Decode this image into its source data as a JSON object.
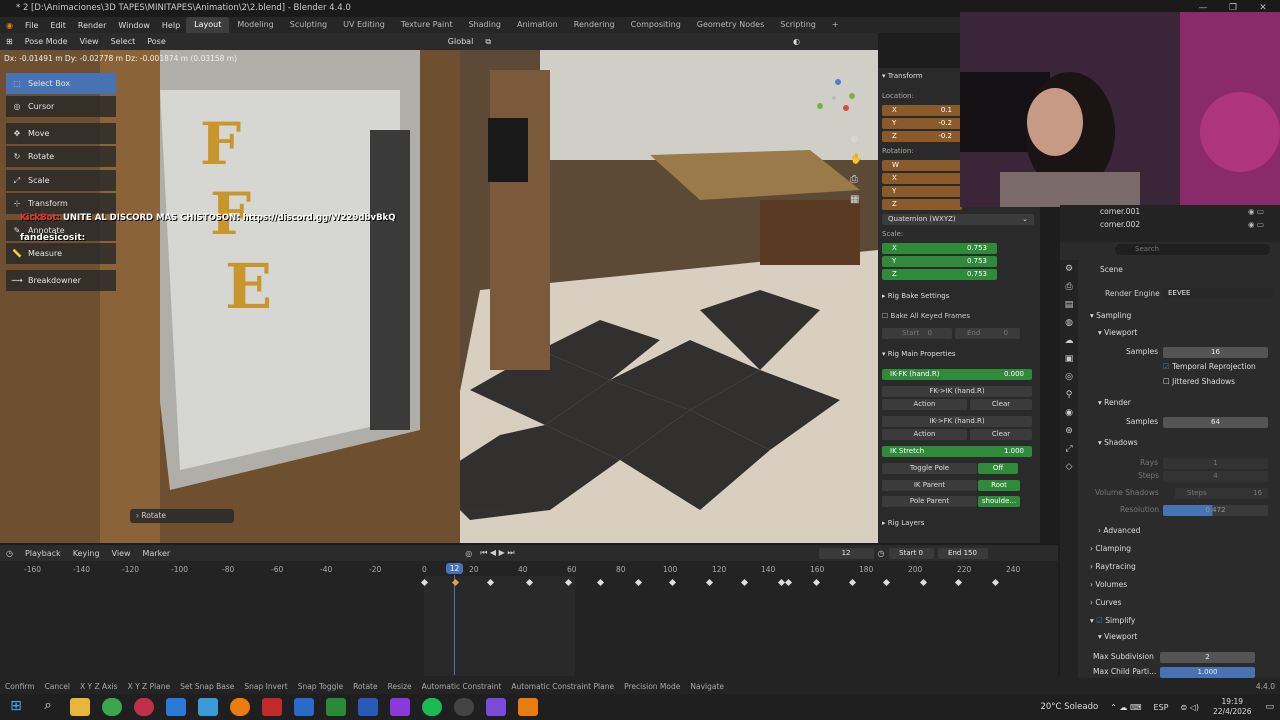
{
  "window": {
    "title": "* 2 [D:\\Animaciones\\3D TAPES\\MINITAPES\\Animation\\2\\2.blend] - Blender 4.4.0"
  },
  "menu": [
    "File",
    "Edit",
    "Render",
    "Window",
    "Help"
  ],
  "workspaces": [
    "Layout",
    "Modeling",
    "Sculpting",
    "UV Editing",
    "Texture Paint",
    "Shading",
    "Animation",
    "Rendering",
    "Compositing",
    "Geometry Nodes",
    "Scripting"
  ],
  "viewport_header": {
    "mode": "Pose Mode",
    "items": [
      "View",
      "Select",
      "Pose"
    ],
    "orientation": "Global"
  },
  "status_delta": "Dx: -0.01491 m  Dy: -0.02778 m  Dz: -0.001874 m (0.03158 m)",
  "tools": [
    "Select Box",
    "Cursor",
    "Move",
    "Rotate",
    "Scale",
    "Transform",
    "Annotate",
    "Measure",
    "Breakdowner"
  ],
  "chat": {
    "user1": "KickBot:",
    "msg1": "UNITE AL DISCORD MAS CHISTOSON: https://discord.gg/W229dbvBkQ",
    "user2": "fandesicosit:"
  },
  "sign_letters": [
    "F",
    "F",
    "E"
  ],
  "last_op": "Rotate",
  "npanel": {
    "transform": "Transform",
    "location": "Location:",
    "loc": [
      {
        "a": "X",
        "v": "0.1"
      },
      {
        "a": "Y",
        "v": "-0.2"
      },
      {
        "a": "Z",
        "v": "-0.2"
      }
    ],
    "rotation": "Rotation:",
    "rot": [
      "W",
      "X",
      "Y",
      "Z"
    ],
    "rotmode": "Quaternion (WXYZ)",
    "scale": "Scale:",
    "scl": [
      {
        "a": "X",
        "v": "0.753"
      },
      {
        "a": "Y",
        "v": "0.753"
      },
      {
        "a": "Z",
        "v": "0.753"
      }
    ],
    "bake": "Rig Bake Settings",
    "bake_all": "Bake All Keyed Frames",
    "start": "Start",
    "start_v": "0",
    "end": "End",
    "end_v": "0",
    "rigmain": "Rig Main Properties",
    "ikfk": "IK-FK (hand.R)",
    "ikfk_v": "0.000",
    "fk2ik": "FK->IK (hand.R)",
    "ik2fk": "IK->FK (hand.R)",
    "action": "Action",
    "clear": "Clear",
    "ikstretch": "IK Stretch",
    "ikstretch_v": "1.000",
    "togglepole": "Toggle Pole",
    "togglepole_v": "Off",
    "ikparent": "IK Parent",
    "ikparent_v": "Root",
    "poleparent": "Pole Parent",
    "poleparent_v": "shoulde...",
    "riglayers": "Rig Layers"
  },
  "outliner": [
    {
      "name": "corner.001"
    },
    {
      "name": "corner.002"
    }
  ],
  "props": {
    "search": "Search",
    "scene": "Scene",
    "engine_label": "Render Engine",
    "engine": "EEVEE",
    "sampling": "Sampling",
    "viewport": "Viewport",
    "samples": "Samples",
    "vp_samples": "16",
    "temporal": "Temporal Reprojection",
    "jittered": "Jittered Shadows",
    "render": "Render",
    "r_samples": "64",
    "shadows": "Shadows",
    "rays": "Rays",
    "rays_v": "1",
    "steps": "Steps",
    "steps_v": "4",
    "vol_shadows": "Volume Shadows",
    "vol_steps": "Steps",
    "vol_steps_v": "16",
    "resolution": "Resolution",
    "resolution_v": "0.472",
    "advanced": "Advanced",
    "clamping": "Clamping",
    "raytracing": "Raytracing",
    "volumes": "Volumes",
    "curves": "Curves",
    "simplify": "Simplify",
    "viewport2": "Viewport",
    "maxsubdiv": "Max Subdivision",
    "maxsubdiv_v": "2",
    "maxchild": "Max Child Parti...",
    "maxchild_v": "1.000"
  },
  "timeline": {
    "items": [
      "Playback",
      "Keying",
      "View",
      "Marker"
    ],
    "current": "12",
    "start_label": "Start",
    "start": "0",
    "end_label": "End",
    "end": "150",
    "ticks": [
      "-160",
      "-140",
      "-120",
      "-100",
      "-80",
      "-60",
      "-40",
      "-20",
      "0",
      "20",
      "40",
      "60",
      "80",
      "100",
      "120",
      "140",
      "160",
      "180",
      "200",
      "220",
      "240"
    ]
  },
  "statusbar": [
    "Confirm",
    "Cancel",
    "X Y Z Axis",
    "X Y Z Plane",
    "Set Snap Base",
    "Snap Invert",
    "Snap Toggle",
    "Rotate",
    "Resize",
    "Automatic Constraint",
    "Automatic Constraint Plane",
    "Precision Mode",
    "Navigate"
  ],
  "version": "4.4.0",
  "taskbar": {
    "weather": "20°C Soleado",
    "lang": "ESP",
    "time": "19:19",
    "date": "22/4/2026"
  }
}
